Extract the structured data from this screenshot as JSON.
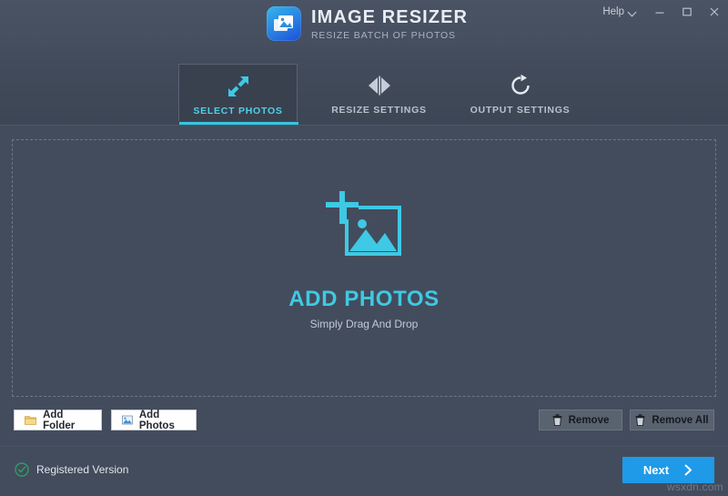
{
  "window": {
    "app_title": "IMAGE RESIZER",
    "app_subtitle": "RESIZE BATCH OF PHOTOS",
    "logo_icon": "image-stack-icon",
    "help_label": "Help",
    "help_chevron_icon": "chevron-down-icon",
    "minimize_icon": "minimize-icon",
    "maximize_icon": "maximize-icon",
    "close_icon": "close-icon"
  },
  "tabs": [
    {
      "id": "select-photos",
      "label": "SELECT PHOTOS",
      "icon": "resize-arrows-icon",
      "active": true
    },
    {
      "id": "resize-settings",
      "label": "RESIZE SETTINGS",
      "icon": "flip-horizontal-icon",
      "active": false
    },
    {
      "id": "output-settings",
      "label": "OUTPUT SETTINGS",
      "icon": "refresh-circle-icon",
      "active": false
    }
  ],
  "dropzone": {
    "icon": "add-photo-icon",
    "title": "ADD PHOTOS",
    "subtitle": "Simply Drag And Drop"
  },
  "actions": {
    "add_folder_label": "Add Folder",
    "add_folder_icon": "folder-icon",
    "add_photos_label": "Add Photos",
    "add_photos_icon": "photo-icon",
    "remove_label": "Remove",
    "remove_icon": "trash-icon",
    "remove_all_label": "Remove All",
    "remove_all_icon": "trash-icon"
  },
  "footer": {
    "registration_status": "Registered Version",
    "registration_icon": "check-circle-icon",
    "next_label": "Next",
    "next_icon": "chevron-right-icon"
  },
  "watermark": {
    "text": "wsxdn.com"
  },
  "colors": {
    "window_bg": "#434c5c",
    "accent_cyan": "#34c6e0",
    "accent_blue": "#1e9ae8",
    "registered_green": "#2e9e63",
    "dashed_border": "#6e7888"
  }
}
